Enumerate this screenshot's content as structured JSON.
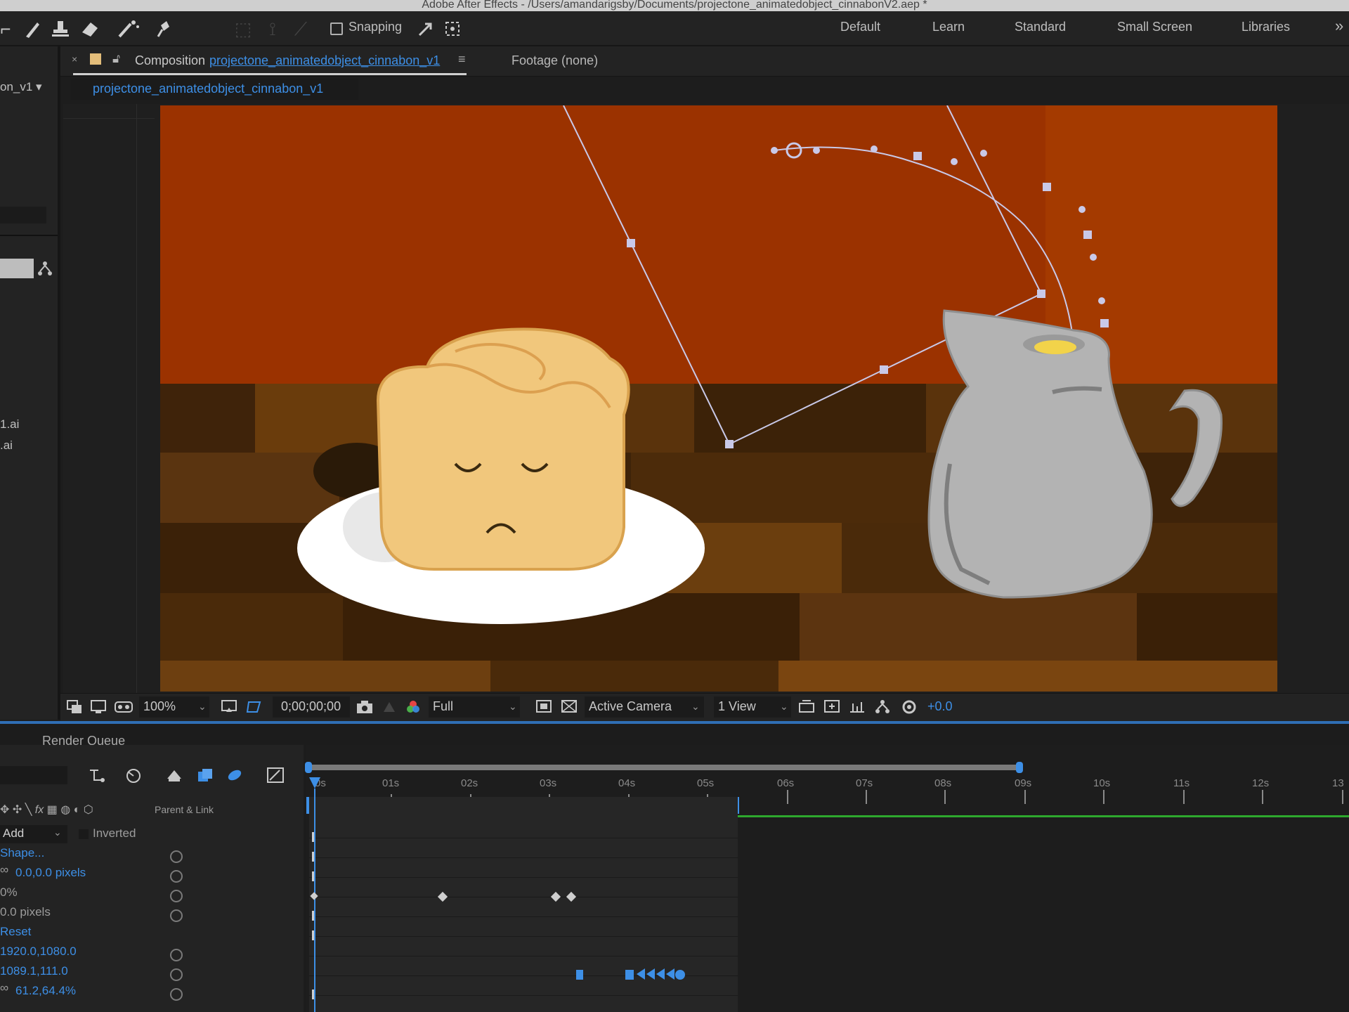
{
  "app": {
    "title": "Adobe After Effects - /Users/amandarigsby/Documents/projectone_animatedobject_cinnabonV2.aep *"
  },
  "toolbar": {
    "snapping_label": "Snapping",
    "snapping_checked": false,
    "workspaces": [
      "Default",
      "Learn",
      "Standard",
      "Small Screen",
      "Libraries"
    ],
    "overflow": "»"
  },
  "left_panel": {
    "comp_name": "on_v1 ▾",
    "items": [
      "1.ai",
      ".ai"
    ]
  },
  "viewer": {
    "composition_prefix": "Composition",
    "composition_name": "projectone_animatedobject_cinnabon_v1",
    "footage_tab": "Footage (none)",
    "breadcrumb": "projectone_animatedobject_cinnabon_v1",
    "zoom": "100%",
    "timecode": "0;00;00;00",
    "resolution": "Full",
    "camera": "Active Camera",
    "views": "1 View",
    "exposure": "+0.0"
  },
  "timeline": {
    "render_queue_tab": "Render Queue",
    "parent_link_header": "Parent & Link",
    "mask_mode": "Add",
    "inverted_label": "Inverted",
    "properties": [
      {
        "value": "Shape...",
        "color": "blue"
      },
      {
        "value": "0.0,0.0 pixels",
        "color": "mixed"
      },
      {
        "value": "0%",
        "color": "grey"
      },
      {
        "value": "0.0 pixels",
        "color": "grey"
      },
      {
        "value": "Reset",
        "color": "blue"
      },
      {
        "value": "1920.0,1080.0",
        "color": "blue"
      },
      {
        "value": "1089.1,111.0",
        "color": "blue"
      },
      {
        "value": "61.2,64.4%",
        "color": "blue"
      }
    ],
    "ruler_ticks": [
      "0s",
      "01s",
      "02s",
      "03s",
      "04s",
      "05s",
      "06s",
      "07s",
      "08s",
      "09s",
      "10s",
      "11s",
      "12s",
      "13"
    ]
  },
  "colors": {
    "accent": "#3d8fe6",
    "wall": "#9b3200",
    "floor": "#4a2a0a",
    "bun": "#f1c77c",
    "pitcher": "#b3b3b3"
  }
}
